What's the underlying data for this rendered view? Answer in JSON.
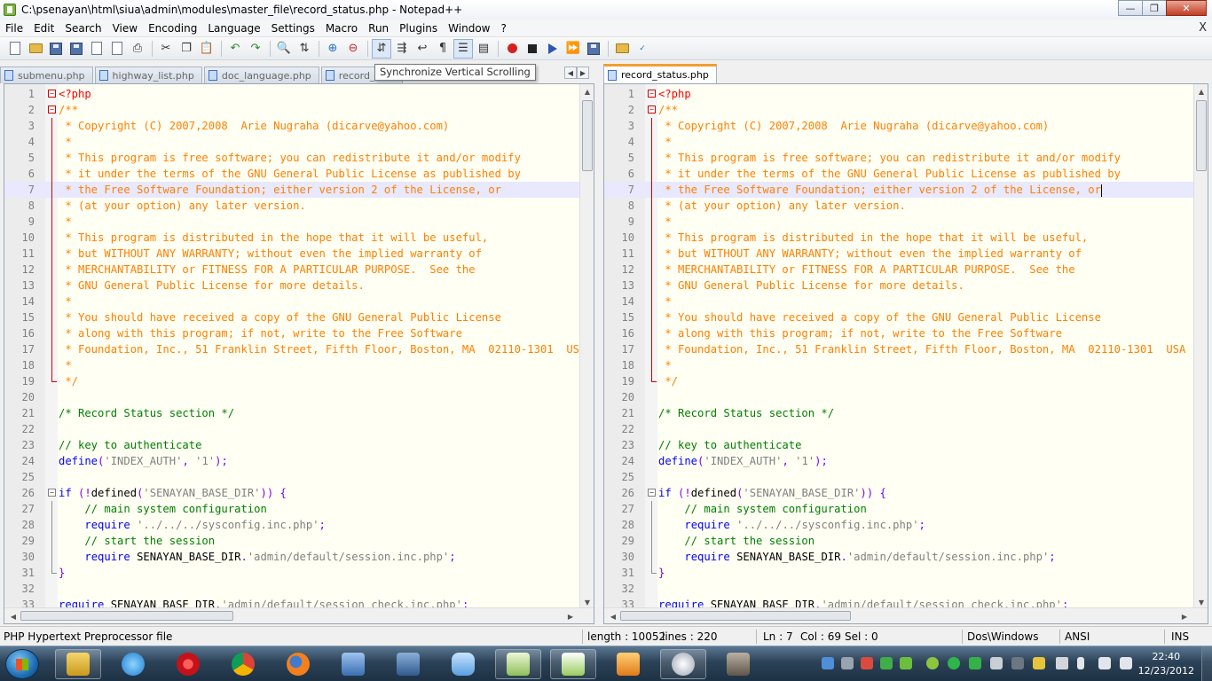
{
  "window": {
    "title": "C:\\psenayan\\html\\siua\\admin\\modules\\master_file\\record_status.php - Notepad++"
  },
  "menu": [
    "File",
    "Edit",
    "Search",
    "View",
    "Encoding",
    "Language",
    "Settings",
    "Macro",
    "Run",
    "Plugins",
    "Window",
    "?"
  ],
  "menu_close": "X",
  "toolbar": {
    "icons": [
      "new-file-icon",
      "open-file-icon",
      "save-icon",
      "save-all-icon",
      "close-icon",
      "close-all-icon",
      "print-icon",
      "cut-icon",
      "copy-icon",
      "paste-icon",
      "undo-icon",
      "redo-icon",
      "find-icon",
      "replace-icon",
      "zoom-in-icon",
      "zoom-out-icon",
      "sync-vertical-scroll-icon",
      "sync-horizontal-scroll-icon",
      "word-wrap-icon",
      "show-all-chars-icon",
      "indent-guide-icon",
      "doc-map-icon",
      "record-macro-icon",
      "stop-macro-icon",
      "play-macro-icon",
      "run-macro-multiple-icon",
      "save-macro-icon",
      "open-folder-icon",
      "spell-check-icon"
    ]
  },
  "tooltip": "Synchronize Vertical Scrolling",
  "tabs_left": [
    {
      "label": "submenu.php"
    },
    {
      "label": "highway_list.php"
    },
    {
      "label": "doc_language.php"
    },
    {
      "label": "record_origin.php"
    }
  ],
  "tabs_right": [
    {
      "label": "record_status.php",
      "active": true
    }
  ],
  "code_lines": [
    {
      "n": "1",
      "t": "<?php",
      "k": "php",
      "fold": "minus"
    },
    {
      "n": "2",
      "t": "/**",
      "k": "cm",
      "fold": "minus"
    },
    {
      "n": "3",
      "t": " * Copyright (C) 2007,2008  Arie Nugraha (dicarve@yahoo.com)",
      "k": "cm"
    },
    {
      "n": "4",
      "t": " *",
      "k": "cm"
    },
    {
      "n": "5",
      "t": " * This program is free software; you can redistribute it and/or modify",
      "k": "cm"
    },
    {
      "n": "6",
      "t": " * it under the terms of the GNU General Public License as published by",
      "k": "cm"
    },
    {
      "n": "7",
      "t": " * the Free Software Foundation; either version 2 of the License, or",
      "k": "cm",
      "current": true
    },
    {
      "n": "8",
      "t": " * (at your option) any later version.",
      "k": "cm"
    },
    {
      "n": "9",
      "t": " *",
      "k": "cm"
    },
    {
      "n": "10",
      "t": " * This program is distributed in the hope that it will be useful,",
      "k": "cm"
    },
    {
      "n": "11",
      "t": " * but WITHOUT ANY WARRANTY; without even the implied warranty of",
      "k": "cm"
    },
    {
      "n": "12",
      "t": " * MERCHANTABILITY or FITNESS FOR A PARTICULAR PURPOSE.  See the",
      "k": "cm"
    },
    {
      "n": "13",
      "t": " * GNU General Public License for more details.",
      "k": "cm"
    },
    {
      "n": "14",
      "t": " *",
      "k": "cm"
    },
    {
      "n": "15",
      "t": " * You should have received a copy of the GNU General Public License",
      "k": "cm"
    },
    {
      "n": "16",
      "t": " * along with this program; if not, write to the Free Software",
      "k": "cm"
    },
    {
      "n": "17",
      "t": " * Foundation, Inc., 51 Franklin Street, Fifth Floor, Boston, MA  02110-1301  USA",
      "k": "cm"
    },
    {
      "n": "18",
      "t": " *",
      "k": "cm"
    },
    {
      "n": "19",
      "t": " */",
      "k": "cm",
      "fold": "end"
    },
    {
      "n": "20",
      "t": "",
      "k": "def"
    },
    {
      "n": "21",
      "t": "/* Record Status section */",
      "k": "cmt"
    },
    {
      "n": "22",
      "t": "",
      "k": "def"
    },
    {
      "n": "23",
      "t": "// key to authenticate",
      "k": "cmt"
    },
    {
      "n": "24",
      "t": [
        [
          "kw",
          "define"
        ],
        [
          "op",
          "("
        ],
        [
          "str",
          "'INDEX_AUTH'"
        ],
        [
          "op",
          ", "
        ],
        [
          "str",
          "'1'"
        ],
        [
          "op",
          ");"
        ]
      ]
    },
    {
      "n": "25",
      "t": "",
      "k": "def"
    },
    {
      "n": "26",
      "t": [
        [
          "kw",
          "if"
        ],
        [
          "op",
          " (!"
        ],
        [
          "def",
          "defined"
        ],
        [
          "op",
          "("
        ],
        [
          "str",
          "'SENAYAN_BASE_DIR'"
        ],
        [
          "op",
          ")) {"
        ]
      ],
      "fold": "minus-grey"
    },
    {
      "n": "27",
      "t": "    // main system configuration",
      "k": "cmt",
      "fold": "line-grey"
    },
    {
      "n": "28",
      "t": [
        [
          "def",
          "    "
        ],
        [
          "kw",
          "require"
        ],
        [
          "def",
          " "
        ],
        [
          "str",
          "'../../../sysconfig.inc.php'"
        ],
        [
          "op",
          ";"
        ]
      ],
      "fold": "line-grey"
    },
    {
      "n": "29",
      "t": "    // start the session",
      "k": "cmt",
      "fold": "line-grey"
    },
    {
      "n": "30",
      "t": [
        [
          "def",
          "    "
        ],
        [
          "kw",
          "require"
        ],
        [
          "def",
          " SENAYAN_BASE_DIR"
        ],
        [
          "op",
          "."
        ],
        [
          "str",
          "'admin/default/session.inc.php'"
        ],
        [
          "op",
          ";"
        ]
      ],
      "fold": "line-grey"
    },
    {
      "n": "31",
      "t": "}",
      "k": "op",
      "fold": "end-grey"
    },
    {
      "n": "32",
      "t": "",
      "k": "def"
    },
    {
      "n": "33",
      "t": [
        [
          "kw",
          "require"
        ],
        [
          "def",
          " SENAYAN_BASE_DIR"
        ],
        [
          "op",
          "."
        ],
        [
          "str",
          "'admin/default/session_check.inc.php'"
        ],
        [
          "op",
          ";"
        ]
      ]
    }
  ],
  "status": {
    "filetype": "PHP Hypertext Preprocessor file",
    "length": "length : 10052",
    "lines": "lines : 220",
    "ln": "Ln : 7",
    "col": "Col : 69",
    "sel": "Sel : 0",
    "eol": "Dos\\Windows",
    "encoding": "ANSI",
    "mode": "INS"
  },
  "taskbar": {
    "apps": [
      "explorer",
      "internet-explorer",
      "opera",
      "chrome",
      "firefox",
      "network-tool",
      "virtualbox",
      "finder",
      "photo-viewer",
      "notepad-plus-plus",
      "media-player",
      "system-monitor",
      "gimp"
    ],
    "time": "22:40",
    "date": "12/23/2012"
  },
  "colors": {
    "php_tag": "#ff0000",
    "doc_comment": "#ff8000",
    "comment": "#008000",
    "keyword": "#0000ff",
    "string": "#808080",
    "operator": "#8000ff",
    "editor_bg": "#fffff3",
    "current_line": "#e8e8ff",
    "active_tab_accent": "#f29e32"
  }
}
